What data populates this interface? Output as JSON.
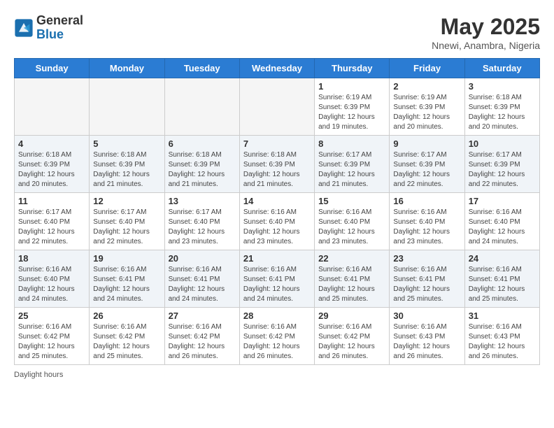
{
  "header": {
    "logo_general": "General",
    "logo_blue": "Blue",
    "month_year": "May 2025",
    "location": "Nnewi, Anambra, Nigeria"
  },
  "weekdays": [
    "Sunday",
    "Monday",
    "Tuesday",
    "Wednesday",
    "Thursday",
    "Friday",
    "Saturday"
  ],
  "weeks": [
    [
      {
        "day": "",
        "info": ""
      },
      {
        "day": "",
        "info": ""
      },
      {
        "day": "",
        "info": ""
      },
      {
        "day": "",
        "info": ""
      },
      {
        "day": "1",
        "info": "Sunrise: 6:19 AM\nSunset: 6:39 PM\nDaylight: 12 hours and 19 minutes."
      },
      {
        "day": "2",
        "info": "Sunrise: 6:19 AM\nSunset: 6:39 PM\nDaylight: 12 hours and 20 minutes."
      },
      {
        "day": "3",
        "info": "Sunrise: 6:18 AM\nSunset: 6:39 PM\nDaylight: 12 hours and 20 minutes."
      }
    ],
    [
      {
        "day": "4",
        "info": "Sunrise: 6:18 AM\nSunset: 6:39 PM\nDaylight: 12 hours and 20 minutes."
      },
      {
        "day": "5",
        "info": "Sunrise: 6:18 AM\nSunset: 6:39 PM\nDaylight: 12 hours and 21 minutes."
      },
      {
        "day": "6",
        "info": "Sunrise: 6:18 AM\nSunset: 6:39 PM\nDaylight: 12 hours and 21 minutes."
      },
      {
        "day": "7",
        "info": "Sunrise: 6:18 AM\nSunset: 6:39 PM\nDaylight: 12 hours and 21 minutes."
      },
      {
        "day": "8",
        "info": "Sunrise: 6:17 AM\nSunset: 6:39 PM\nDaylight: 12 hours and 21 minutes."
      },
      {
        "day": "9",
        "info": "Sunrise: 6:17 AM\nSunset: 6:39 PM\nDaylight: 12 hours and 22 minutes."
      },
      {
        "day": "10",
        "info": "Sunrise: 6:17 AM\nSunset: 6:39 PM\nDaylight: 12 hours and 22 minutes."
      }
    ],
    [
      {
        "day": "11",
        "info": "Sunrise: 6:17 AM\nSunset: 6:40 PM\nDaylight: 12 hours and 22 minutes."
      },
      {
        "day": "12",
        "info": "Sunrise: 6:17 AM\nSunset: 6:40 PM\nDaylight: 12 hours and 22 minutes."
      },
      {
        "day": "13",
        "info": "Sunrise: 6:17 AM\nSunset: 6:40 PM\nDaylight: 12 hours and 23 minutes."
      },
      {
        "day": "14",
        "info": "Sunrise: 6:16 AM\nSunset: 6:40 PM\nDaylight: 12 hours and 23 minutes."
      },
      {
        "day": "15",
        "info": "Sunrise: 6:16 AM\nSunset: 6:40 PM\nDaylight: 12 hours and 23 minutes."
      },
      {
        "day": "16",
        "info": "Sunrise: 6:16 AM\nSunset: 6:40 PM\nDaylight: 12 hours and 23 minutes."
      },
      {
        "day": "17",
        "info": "Sunrise: 6:16 AM\nSunset: 6:40 PM\nDaylight: 12 hours and 24 minutes."
      }
    ],
    [
      {
        "day": "18",
        "info": "Sunrise: 6:16 AM\nSunset: 6:40 PM\nDaylight: 12 hours and 24 minutes."
      },
      {
        "day": "19",
        "info": "Sunrise: 6:16 AM\nSunset: 6:41 PM\nDaylight: 12 hours and 24 minutes."
      },
      {
        "day": "20",
        "info": "Sunrise: 6:16 AM\nSunset: 6:41 PM\nDaylight: 12 hours and 24 minutes."
      },
      {
        "day": "21",
        "info": "Sunrise: 6:16 AM\nSunset: 6:41 PM\nDaylight: 12 hours and 24 minutes."
      },
      {
        "day": "22",
        "info": "Sunrise: 6:16 AM\nSunset: 6:41 PM\nDaylight: 12 hours and 25 minutes."
      },
      {
        "day": "23",
        "info": "Sunrise: 6:16 AM\nSunset: 6:41 PM\nDaylight: 12 hours and 25 minutes."
      },
      {
        "day": "24",
        "info": "Sunrise: 6:16 AM\nSunset: 6:41 PM\nDaylight: 12 hours and 25 minutes."
      }
    ],
    [
      {
        "day": "25",
        "info": "Sunrise: 6:16 AM\nSunset: 6:42 PM\nDaylight: 12 hours and 25 minutes."
      },
      {
        "day": "26",
        "info": "Sunrise: 6:16 AM\nSunset: 6:42 PM\nDaylight: 12 hours and 25 minutes."
      },
      {
        "day": "27",
        "info": "Sunrise: 6:16 AM\nSunset: 6:42 PM\nDaylight: 12 hours and 26 minutes."
      },
      {
        "day": "28",
        "info": "Sunrise: 6:16 AM\nSunset: 6:42 PM\nDaylight: 12 hours and 26 minutes."
      },
      {
        "day": "29",
        "info": "Sunrise: 6:16 AM\nSunset: 6:42 PM\nDaylight: 12 hours and 26 minutes."
      },
      {
        "day": "30",
        "info": "Sunrise: 6:16 AM\nSunset: 6:43 PM\nDaylight: 12 hours and 26 minutes."
      },
      {
        "day": "31",
        "info": "Sunrise: 6:16 AM\nSunset: 6:43 PM\nDaylight: 12 hours and 26 minutes."
      }
    ]
  ],
  "footer": {
    "note": "Daylight hours"
  }
}
